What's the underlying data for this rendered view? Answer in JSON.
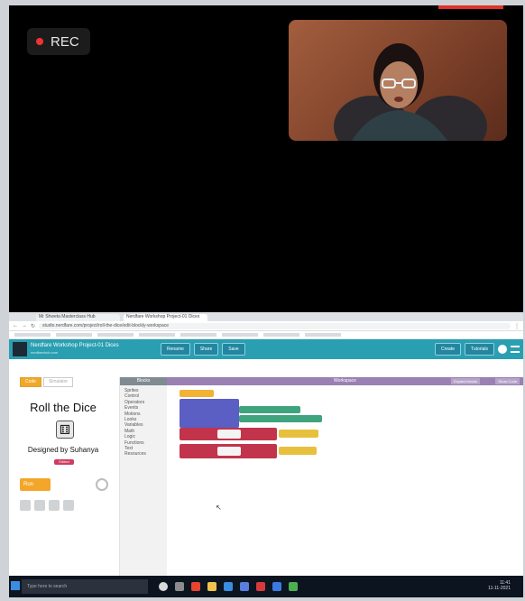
{
  "recording": {
    "label": "REC"
  },
  "browser": {
    "tabs": [
      "Mr Shweta Masterclass Hub",
      "Nerdfare Workshop Project-01 Dices"
    ],
    "url": "studio.nerdfare.com/project/roll-the-dice/edit-blockly-workspace"
  },
  "app": {
    "project_title": "Nerdfare Workshop Project-01 Dices",
    "subtitle": "nerdfarehub.com",
    "header_buttons": [
      "Rename",
      "Share",
      "Save"
    ],
    "right_buttons": [
      "Create",
      "Tutorials"
    ]
  },
  "left_panel": {
    "toggle": [
      "Code",
      "Simulator"
    ],
    "title": "Roll the Dice",
    "dice_face": "⚅",
    "designed_by": "Designed by Suhanya",
    "badge": "Edited",
    "run_label": "Run"
  },
  "categories": {
    "header": "Blocks",
    "items": [
      "Sprites",
      "Control",
      "Operators",
      "Events",
      "Motions",
      "Looks",
      "Variables",
      "Math",
      "Logic",
      "Functions",
      "Text",
      "Resources"
    ]
  },
  "workspace": {
    "header": "Workspace",
    "buttons": [
      "Expand blocks",
      "Show Code"
    ]
  },
  "taskbar": {
    "search_placeholder": "Type here to search",
    "time": "11:41",
    "date": "11-11-2021"
  }
}
